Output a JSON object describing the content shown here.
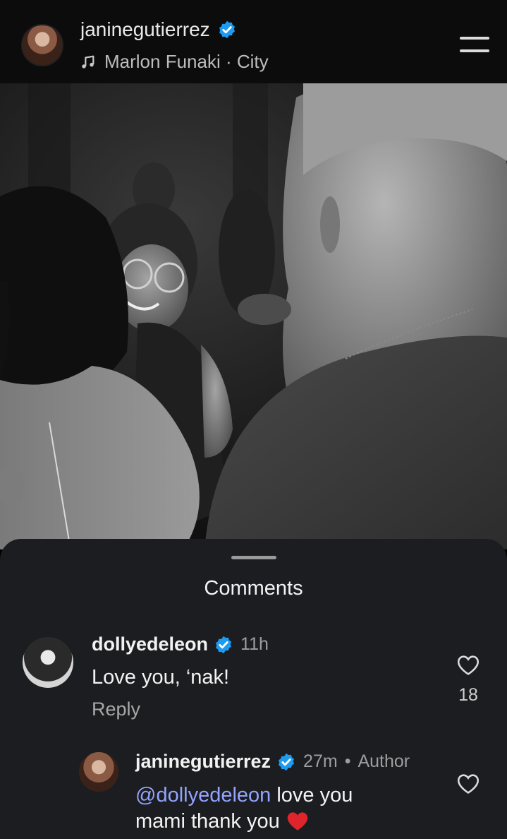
{
  "header": {
    "username": "janinegutierrez",
    "music": "Marlon Funaki · City"
  },
  "comments_sheet": {
    "title": "Comments",
    "comments": [
      {
        "username": "dollyedeleon",
        "time": "11h",
        "text": "Love you, ‘nak!",
        "reply_label": "Reply",
        "likes": "18"
      }
    ],
    "replies": [
      {
        "username": "janinegutierrez",
        "time": "27m",
        "author_tag": "Author",
        "mention": "@dollyedeleon",
        "text_line1": " love you",
        "text_line2": "mami thank you"
      }
    ]
  },
  "colors": {
    "verified": "#1d9bf0",
    "mention": "#93a4ff",
    "sheet_bg": "#1c1d21",
    "heart_emoji": "#e0242b"
  },
  "icons": [
    "verified-badge-icon",
    "music-note-icon",
    "menu-icon",
    "heart-outline-icon",
    "heart-emoji-icon"
  ]
}
